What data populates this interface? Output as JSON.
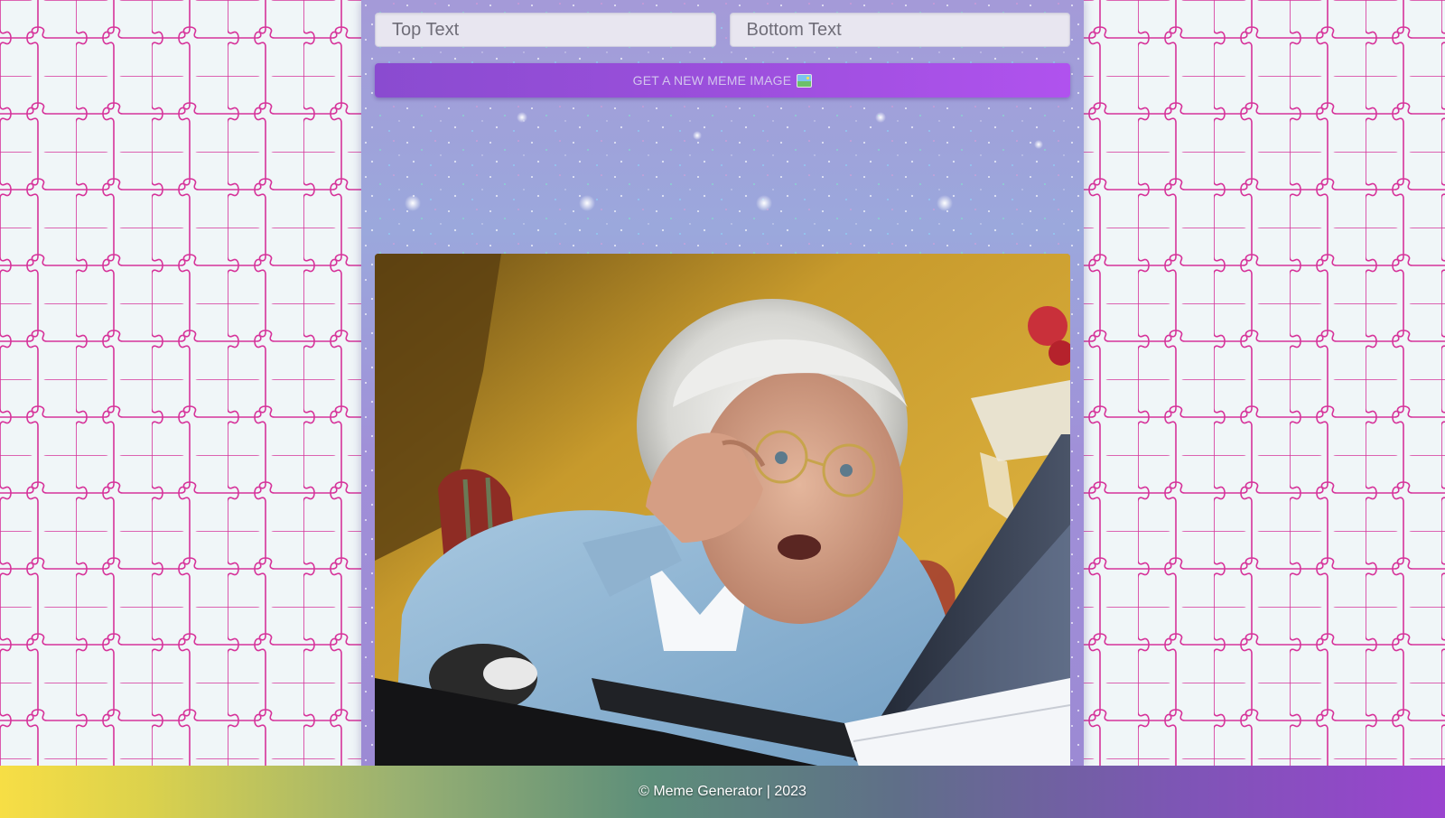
{
  "colors": {
    "page_background": "#f0f6f8",
    "puzzle_line": "#d6339a",
    "panel_background": "#9ea2da",
    "button_gradient_start": "#8a4bd0",
    "button_gradient_end": "#b052ee",
    "footer_gradient_start": "#f7de45",
    "footer_gradient_end": "#9a43cf"
  },
  "form": {
    "top_text": {
      "placeholder": "Top Text",
      "value": ""
    },
    "bottom_text": {
      "placeholder": "Bottom Text",
      "value": ""
    },
    "new_image_button": {
      "label": "GET A NEW MEME IMAGE",
      "icon": "picture-icon"
    }
  },
  "meme": {
    "top_caption": "",
    "bottom_caption": ""
  },
  "footer": {
    "text": "© Meme Generator | 2023"
  }
}
